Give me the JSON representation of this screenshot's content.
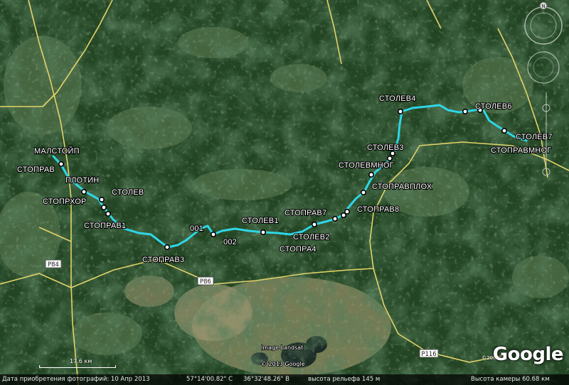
{
  "map": {
    "waypoints": [
      {
        "label": "МАЛСТОЙП"
      },
      {
        "label": "СТОПРАВ"
      },
      {
        "label": "ПЛОТИН"
      },
      {
        "label": "СТОЛЕВ"
      },
      {
        "label": "СТОПРХОР"
      },
      {
        "label": "СТОПРАВ1"
      },
      {
        "label": "СТОПРАВ3"
      },
      {
        "label": "001"
      },
      {
        "label": "002"
      },
      {
        "label": "СТОЛЕВ1"
      },
      {
        "label": "СТОПРАВ7"
      },
      {
        "label": "СТОЛЕВ2"
      },
      {
        "label": "СТОПРА4"
      },
      {
        "label": "СТОПРАВ8"
      },
      {
        "label": "СТОПРАВПЛОХ"
      },
      {
        "label": "СТОЛЕВМНОГ"
      },
      {
        "label": "СТОЛЕВ3"
      },
      {
        "label": "СТОЛЕВ4"
      },
      {
        "label": "СТОЛЕВ6"
      },
      {
        "label": "СТОЛЕВ7"
      },
      {
        "label": "СТОПРАВМНОГ"
      }
    ],
    "road_labels": [
      "Р84",
      "Р86",
      "Р116"
    ],
    "imagery_credit": "Image Landsat",
    "copyright": "© 2013 Google",
    "copyright_year": "©2009",
    "logo": "Google",
    "scale_label": "17.6 км",
    "colors": {
      "track": "#2fd6e6",
      "road": "#e3d36a",
      "forest": "#213f22"
    }
  },
  "status_bar": {
    "date": "Дата приобретения фотографий:  10 Апр 2013",
    "lat": "57°14'00.82\" С",
    "lon": "36°32'48.26\" В",
    "elevation": "высота рельефа  145 м",
    "eye_alt": "Высота камеры   60.68 км"
  },
  "nav_control": {
    "north": "N"
  }
}
